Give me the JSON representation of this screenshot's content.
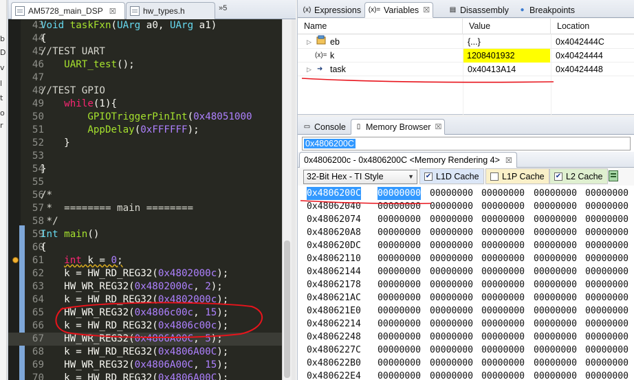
{
  "left_strip": {
    "fragments": [
      "b",
      "D",
      "v",
      "l",
      "t",
      "o",
      "r"
    ]
  },
  "editor": {
    "tabs": [
      {
        "label": "AM5728_main_DSP",
        "close": "☒"
      },
      {
        "label": "hw_types.h",
        "close": ""
      }
    ],
    "tab_overflow": "»5",
    "ctrls": "⊟ ▭",
    "lines": [
      {
        "n": "43",
        "tokens": [
          [
            "Void ",
            "type"
          ],
          [
            "taskFxn",
            "fn"
          ],
          [
            "(",
            ""
          ],
          [
            "UArg",
            "type"
          ],
          [
            " a0, ",
            ""
          ],
          [
            "UArg",
            "type"
          ],
          [
            " a1)",
            ""
          ]
        ]
      },
      {
        "n": "44",
        "tokens": [
          [
            "{",
            ""
          ]
        ]
      },
      {
        "n": "45",
        "tokens": [
          [
            "//TEST UART",
            "com"
          ]
        ]
      },
      {
        "n": "46",
        "tokens": [
          [
            "    ",
            ""
          ],
          [
            "UART_test",
            "fn"
          ],
          [
            "();",
            ""
          ]
        ]
      },
      {
        "n": "47",
        "tokens": []
      },
      {
        "n": "48",
        "tokens": [
          [
            "//TEST GPIO",
            "com"
          ]
        ]
      },
      {
        "n": "49",
        "tokens": [
          [
            "    ",
            ""
          ],
          [
            "while",
            "kw"
          ],
          [
            "(1){",
            ""
          ]
        ]
      },
      {
        "n": "50",
        "tokens": [
          [
            "        ",
            ""
          ],
          [
            "GPIOTriggerPinInt",
            "fn"
          ],
          [
            "(",
            ""
          ],
          [
            "0x48051000",
            "num"
          ]
        ]
      },
      {
        "n": "51",
        "tokens": [
          [
            "        ",
            ""
          ],
          [
            "AppDelay",
            "fn"
          ],
          [
            "(",
            ""
          ],
          [
            "0xFFFFFF",
            "num"
          ],
          [
            ");",
            ""
          ]
        ]
      },
      {
        "n": "52",
        "tokens": [
          [
            "    }",
            ""
          ]
        ]
      },
      {
        "n": "53",
        "tokens": []
      },
      {
        "n": "54",
        "tokens": [
          [
            "}",
            ""
          ]
        ]
      },
      {
        "n": "55",
        "tokens": []
      },
      {
        "n": "56",
        "tokens": [
          [
            "/*",
            "com"
          ]
        ]
      },
      {
        "n": "57",
        "tokens": [
          [
            " *  ======== main ========",
            "com"
          ]
        ]
      },
      {
        "n": "58",
        "tokens": [
          [
            " */",
            "com"
          ]
        ]
      },
      {
        "n": "59",
        "tokens": [
          [
            "Int ",
            "type"
          ],
          [
            "main",
            "fn"
          ],
          [
            "()",
            ""
          ]
        ]
      },
      {
        "n": "60",
        "tokens": [
          [
            "{",
            ""
          ]
        ]
      },
      {
        "n": "61",
        "tokens": [
          [
            "    ",
            ""
          ],
          [
            "int",
            "kw wavy"
          ],
          [
            " k = ",
            "wavy"
          ],
          [
            "0",
            "num wavy"
          ],
          [
            ";",
            "wavy"
          ]
        ]
      },
      {
        "n": "62",
        "tokens": [
          [
            "    k = HW_RD_REG32(",
            ""
          ],
          [
            "0x4802000c",
            "num"
          ],
          [
            ");",
            ""
          ]
        ]
      },
      {
        "n": "63",
        "tokens": [
          [
            "    HW_WR_REG32(",
            ""
          ],
          [
            "0x4802000c",
            "num"
          ],
          [
            ", ",
            ""
          ],
          [
            "2",
            "num"
          ],
          [
            ");",
            ""
          ]
        ]
      },
      {
        "n": "64",
        "tokens": [
          [
            "    k = HW_RD_REG32(",
            ""
          ],
          [
            "0x4802000c",
            "num"
          ],
          [
            ");",
            ""
          ]
        ]
      },
      {
        "n": "65",
        "tokens": [
          [
            "    HW_WR_REG32(",
            ""
          ],
          [
            "0x4806c00c",
            "num"
          ],
          [
            ", ",
            ""
          ],
          [
            "15",
            "num"
          ],
          [
            ");",
            ""
          ]
        ]
      },
      {
        "n": "66",
        "tokens": [
          [
            "    k = HW_RD_REG32(",
            ""
          ],
          [
            "0x4806c00c",
            "num"
          ],
          [
            ");",
            ""
          ]
        ]
      },
      {
        "n": "67",
        "tokens": [
          [
            "    HW_WR_REG32(",
            ""
          ],
          [
            "0x4806A00C",
            "num"
          ],
          [
            ", ",
            ""
          ],
          [
            "5",
            "num"
          ],
          [
            ");",
            ""
          ]
        ]
      },
      {
        "n": "68",
        "tokens": [
          [
            "    k = HW_RD_REG32(",
            ""
          ],
          [
            "0x4806A00C",
            "num"
          ],
          [
            ");",
            ""
          ]
        ]
      },
      {
        "n": "69",
        "tokens": [
          [
            "    HW_WR_REG32(",
            ""
          ],
          [
            "0x4806A00C",
            "num"
          ],
          [
            ", ",
            ""
          ],
          [
            "15",
            "num"
          ],
          [
            ");",
            ""
          ]
        ]
      },
      {
        "n": "70",
        "tokens": [
          [
            "    k = HW_RD_REG32(",
            ""
          ],
          [
            "0x4806A00C",
            "num"
          ],
          [
            ");",
            ""
          ]
        ]
      }
    ]
  },
  "debug_views": {
    "tabs": [
      {
        "label": "Expressions",
        "icon": "(x)",
        "active": false
      },
      {
        "label": "Variables",
        "icon": "(x)=",
        "active": true,
        "close": "☒"
      },
      {
        "label": "Disassembly",
        "icon": "▤",
        "active": false
      },
      {
        "label": "Breakpoints",
        "icon": "●",
        "active": false
      }
    ],
    "columns": [
      "Name",
      "Value",
      "Location"
    ],
    "rows": [
      {
        "toggle": "▷",
        "icon": "struct-icon",
        "name": "eb",
        "value": "{...}",
        "location": "0x4042444C"
      },
      {
        "toggle": "",
        "icon": "(x)=",
        "name": "k",
        "value": "1208401932",
        "location": "0x40424444"
      },
      {
        "toggle": "▷",
        "icon": "➜",
        "name": "task",
        "value": "0x40413A14",
        "location": "0x40424448"
      }
    ]
  },
  "memory_panel": {
    "tabs": [
      {
        "label": "Console",
        "icon": "▭",
        "active": false
      },
      {
        "label": "Memory Browser",
        "icon": "▯",
        "active": true,
        "close": "☒"
      }
    ],
    "address_input": "0x4806200C",
    "rendering_tab": "0x4806200c - 0x4806200C <Memory Rendering 4>",
    "rendering_close": "☒",
    "format": "32-Bit Hex - TI Style",
    "caches": [
      {
        "label": "L1D Cache",
        "checked": true
      },
      {
        "label": "L1P Cache",
        "checked": false
      },
      {
        "label": "L2 Cache",
        "checked": true
      }
    ],
    "rows": [
      {
        "addr": "0x4806200C",
        "words": [
          "00000000",
          "00000000",
          "00000000",
          "00000000",
          "00000000"
        ]
      },
      {
        "addr": "0x48062040",
        "words": [
          "00000000",
          "00000000",
          "00000000",
          "00000000",
          "00000000"
        ]
      },
      {
        "addr": "0x48062074",
        "words": [
          "00000000",
          "00000000",
          "00000000",
          "00000000",
          "00000000"
        ]
      },
      {
        "addr": "0x480620A8",
        "words": [
          "00000000",
          "00000000",
          "00000000",
          "00000000",
          "00000000"
        ]
      },
      {
        "addr": "0x480620DC",
        "words": [
          "00000000",
          "00000000",
          "00000000",
          "00000000",
          "00000000"
        ]
      },
      {
        "addr": "0x48062110",
        "words": [
          "00000000",
          "00000000",
          "00000000",
          "00000000",
          "00000000"
        ]
      },
      {
        "addr": "0x48062144",
        "words": [
          "00000000",
          "00000000",
          "00000000",
          "00000000",
          "00000000"
        ]
      },
      {
        "addr": "0x48062178",
        "words": [
          "00000000",
          "00000000",
          "00000000",
          "00000000",
          "00000000"
        ]
      },
      {
        "addr": "0x480621AC",
        "words": [
          "00000000",
          "00000000",
          "00000000",
          "00000000",
          "00000000"
        ]
      },
      {
        "addr": "0x480621E0",
        "words": [
          "00000000",
          "00000000",
          "00000000",
          "00000000",
          "00000000"
        ]
      },
      {
        "addr": "0x48062214",
        "words": [
          "00000000",
          "00000000",
          "00000000",
          "00000000",
          "00000000"
        ]
      },
      {
        "addr": "0x48062248",
        "words": [
          "00000000",
          "00000000",
          "00000000",
          "00000000",
          "00000000"
        ]
      },
      {
        "addr": "0x4806227C",
        "words": [
          "00000000",
          "00000000",
          "00000000",
          "00000000",
          "00000000"
        ]
      },
      {
        "addr": "0x480622B0",
        "words": [
          "00000000",
          "00000000",
          "00000000",
          "00000000",
          "00000000"
        ]
      },
      {
        "addr": "0x480622E4",
        "words": [
          "00000000",
          "00000000",
          "00000000",
          "00000000",
          "00000000"
        ]
      }
    ]
  },
  "colors": {
    "annotation_red": "#e8141c",
    "value_highlight": "#ffff00",
    "selection_blue": "#3399ff"
  }
}
